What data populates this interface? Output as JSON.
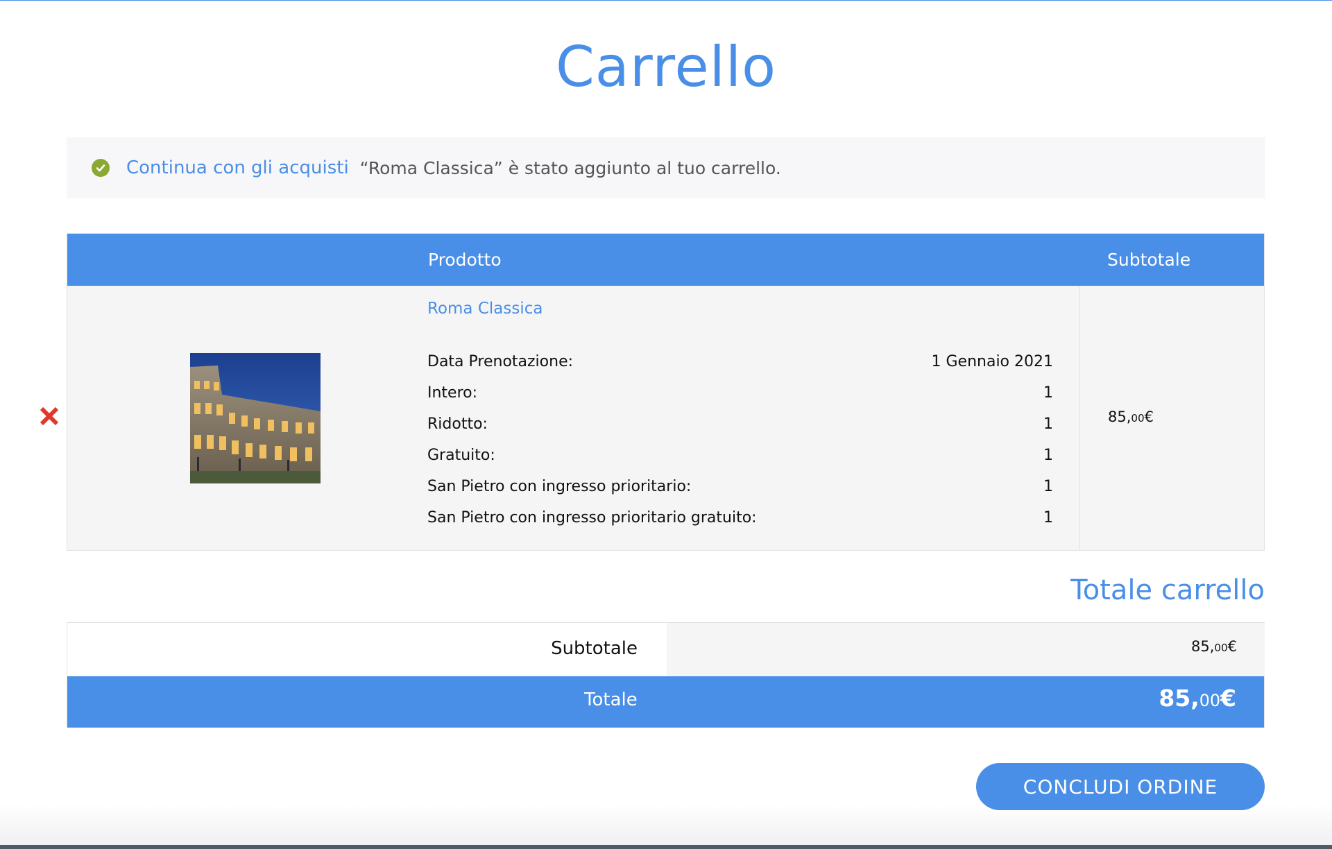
{
  "page": {
    "title": "Carrello"
  },
  "notice": {
    "icon": "check-circle-icon",
    "link_label": "Continua con gli acquisti",
    "message": "“Roma Classica” è stato aggiunto al tuo carrello."
  },
  "cart": {
    "headers": {
      "product": "Prodotto",
      "subtotal": "Subtotale"
    },
    "item": {
      "remove_icon": "remove-x-icon",
      "thumbnail": "colosseum-photo",
      "name": "Roma Classica",
      "meta": [
        {
          "label": "Data Prenotazione:",
          "value": "1 Gennaio 2021"
        },
        {
          "label": "Intero:",
          "value": "1"
        },
        {
          "label": "Ridotto:",
          "value": "1"
        },
        {
          "label": "Gratuito:",
          "value": "1"
        },
        {
          "label": "San Pietro con ingresso prioritario:",
          "value": "1"
        },
        {
          "label": "San Pietro con ingresso prioritario gratuito:",
          "value": "1"
        }
      ],
      "subtotal_int": "85,",
      "subtotal_cents": "00",
      "subtotal_currency": "€"
    }
  },
  "totals": {
    "title": "Totale carrello",
    "subtotal_label": "Subtotale",
    "subtotal_int": "85,",
    "subtotal_cents": "00",
    "subtotal_currency": "€",
    "total_label": "Totale",
    "total_int": "85,",
    "total_cents": "00",
    "total_currency": "€"
  },
  "checkout": {
    "label": "CONCLUDI ORDINE"
  },
  "colors": {
    "accent": "#4a8fe7",
    "success": "#8aa933",
    "danger": "#e0392b"
  }
}
